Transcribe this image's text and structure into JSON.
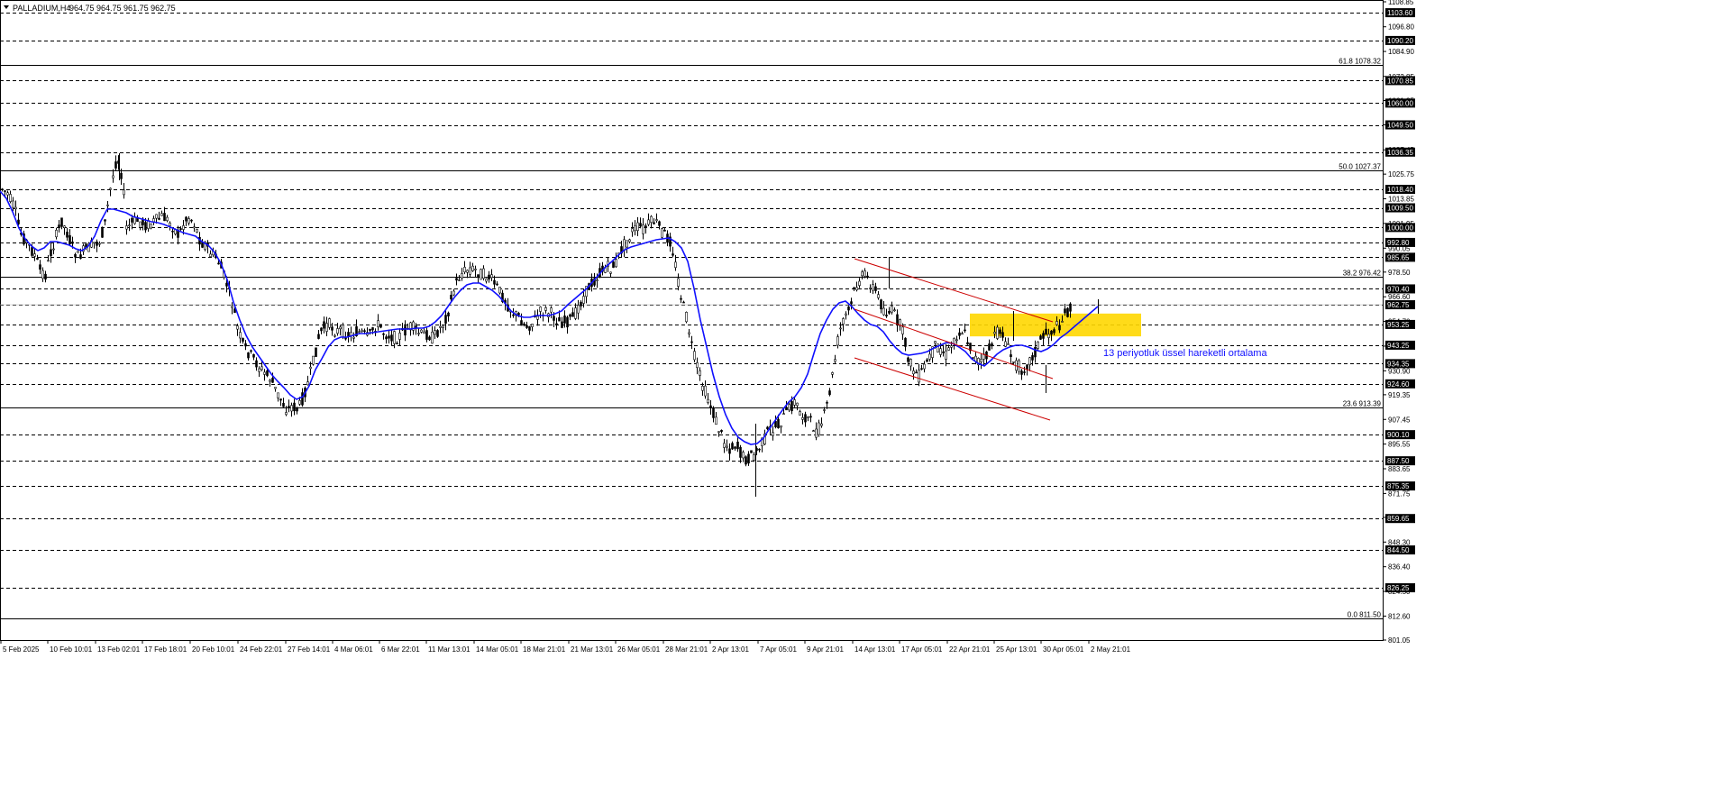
{
  "header": {
    "title": "PALLADIUM,H4",
    "ohlc": "964.75 964.75 961.75 962.75"
  },
  "chart_data": {
    "type": "candlestick",
    "symbol": "PALLADIUM",
    "timeframe": "H4",
    "ylim": [
      801.05,
      1108.85
    ],
    "grid": "dashed horizontal lines at marked price levels",
    "last_price": 962.75,
    "y_ticks": [
      "1108.85",
      "1096.80",
      "1084.90",
      "1072.85",
      "1061.25",
      "1049.50",
      "1037.45",
      "1025.75",
      "1013.85",
      "1001.95",
      "990.05",
      "978.50",
      "966.60",
      "954.70",
      "942.80",
      "930.90",
      "919.35",
      "907.45",
      "895.55",
      "883.65",
      "871.75",
      "860.20",
      "848.30",
      "836.40",
      "824.50",
      "812.60",
      "801.05"
    ],
    "y_tick_values": [
      1108.85,
      1096.8,
      1084.9,
      1072.85,
      1061.25,
      1049.5,
      1037.45,
      1025.75,
      1013.85,
      1001.95,
      990.05,
      978.5,
      966.6,
      954.7,
      942.8,
      930.9,
      919.35,
      907.45,
      895.55,
      883.65,
      871.75,
      860.2,
      848.3,
      836.4,
      824.5,
      812.6,
      801.05
    ],
    "price_levels": [
      "1103.60",
      "1090.20",
      "1070.85",
      "1060.00",
      "1049.50",
      "1036.35",
      "1018.40",
      "1009.50",
      "1000.00",
      "992.80",
      "985.65",
      "970.40",
      "962.75",
      "953.25",
      "943.25",
      "934.35",
      "924.60",
      "900.10",
      "887.50",
      "875.35",
      "859.65",
      "844.50",
      "826.25"
    ],
    "price_level_values": [
      1103.6,
      1090.2,
      1070.85,
      1060.0,
      1049.5,
      1036.35,
      1018.4,
      1009.5,
      1000.0,
      992.8,
      985.65,
      970.4,
      962.75,
      953.25,
      943.25,
      934.35,
      924.6,
      900.1,
      887.5,
      875.35,
      859.65,
      844.5,
      826.25
    ],
    "fibonacci": [
      {
        "label": "61.8 1078.32",
        "value": 1078.32
      },
      {
        "label": "50.0 1027.37",
        "value": 1027.37
      },
      {
        "label": "38.2 976.42",
        "value": 976.42
      },
      {
        "label": "23.6 913.39",
        "value": 913.39
      },
      {
        "label": "0.0 811.50",
        "value": 811.5
      }
    ],
    "x_labels": [
      "5 Feb 2025",
      "10 Feb 10:01",
      "13 Feb 02:01",
      "17 Feb 18:01",
      "20 Feb 10:01",
      "24 Feb 22:01",
      "27 Feb 14:01",
      "4 Mar 06:01",
      "6 Mar 22:01",
      "11 Mar 13:01",
      "14 Mar 05:01",
      "18 Mar 21:01",
      "21 Mar 13:01",
      "26 Mar 05:01",
      "28 Mar 21:01",
      "2 Apr 13:01",
      "7 Apr 05:01",
      "9 Apr 21:01",
      "14 Apr 13:01",
      "17 Apr 05:01",
      "22 Apr 21:01",
      "25 Apr 13:01",
      "30 Apr 05:01",
      "2 May 21:01"
    ],
    "price_path": {
      "x": [
        0,
        8,
        16,
        22,
        30,
        38,
        44,
        50,
        56,
        62,
        68,
        74,
        80,
        86,
        92,
        98,
        104,
        110,
        116,
        122,
        128,
        132,
        136,
        140,
        144,
        150,
        156,
        162,
        168,
        174,
        180,
        186,
        192,
        198,
        204,
        210,
        216,
        222,
        228,
        234,
        240,
        246,
        252,
        258,
        264,
        270,
        276,
        282,
        288,
        294,
        300,
        306,
        312,
        318,
        324,
        330,
        336,
        342,
        348,
        354,
        360,
        366,
        372,
        378,
        384,
        390,
        396,
        402,
        408,
        414,
        420,
        426,
        432,
        438,
        444,
        450,
        456,
        462,
        468,
        474,
        480,
        486,
        492,
        498,
        504,
        510,
        516,
        522,
        528,
        534,
        540,
        546,
        552,
        558,
        564,
        570,
        576,
        582,
        588,
        594,
        600,
        606,
        612,
        618,
        624,
        630,
        636,
        642,
        648,
        654,
        660,
        666,
        672,
        678,
        684,
        690,
        696,
        702,
        708,
        714,
        720,
        726,
        732,
        738,
        744,
        750,
        756,
        762,
        768,
        774,
        780,
        786,
        792,
        798,
        804,
        810,
        816,
        822,
        828,
        834,
        840,
        846,
        852,
        858,
        864,
        870,
        876,
        882,
        888,
        894,
        900,
        906,
        912,
        918,
        924,
        930,
        936,
        942,
        948,
        954,
        960,
        966,
        972,
        978,
        984,
        990,
        996,
        1002,
        1008,
        1014,
        1020,
        1026,
        1032,
        1038,
        1044,
        1050,
        1056,
        1062,
        1068,
        1074,
        1080,
        1086,
        1092,
        1098,
        1104,
        1110,
        1116,
        1122,
        1128,
        1134,
        1140,
        1146,
        1152,
        1158,
        1164,
        1170,
        1176,
        1182,
        1188,
        1194,
        1200,
        1206,
        1212,
        1218
      ],
      "y": [
        208,
        215,
        232,
        258,
        270,
        283,
        300,
        305,
        280,
        262,
        245,
        258,
        275,
        285,
        279,
        275,
        270,
        268,
        248,
        210,
        180,
        178,
        205,
        252,
        250,
        245,
        246,
        250,
        247,
        244,
        240,
        245,
        252,
        262,
        246,
        240,
        250,
        268,
        272,
        282,
        286,
        300,
        318,
        340,
        368,
        385,
        392,
        400,
        408,
        415,
        420,
        435,
        445,
        455,
        450,
        455,
        440,
        422,
        398,
        370,
        362,
        360,
        368,
        366,
        370,
        372,
        368,
        370,
        375,
        364,
        360,
        370,
        372,
        375,
        372,
        366,
        362,
        368,
        372,
        370,
        375,
        366,
        358,
        342,
        318,
        305,
        300,
        298,
        300,
        304,
        306,
        312,
        320,
        330,
        340,
        348,
        352,
        362,
        360,
        354,
        345,
        345,
        349,
        355,
        358,
        356,
        353,
        338,
        328,
        316,
        310,
        302,
        296,
        298,
        290,
        274,
        266,
        255,
        252,
        254,
        248,
        245,
        254,
        262,
        268,
        300,
        334,
        355,
        390,
        410,
        430,
        445,
        462,
        478,
        492,
        498,
        492,
        505,
        510,
        506,
        500,
        490,
        478,
        476,
        470,
        462,
        452,
        445,
        460,
        462,
        470,
        480,
        468,
        446,
        412,
        372,
        352,
        345,
        320,
        308,
        305,
        315,
        325,
        340,
        348,
        345,
        356,
        372,
        400,
        412,
        418,
        405,
        395,
        382,
        388,
        395,
        380,
        370,
        366,
        380,
        395,
        402,
        398,
        386,
        372,
        365,
        382,
        398,
        405,
        410,
        402,
        395,
        380,
        372,
        368,
        365,
        358,
        348,
        340
      ]
    },
    "ema": {
      "label": "13 periyotluk üssel hareketli ortalama",
      "color": "#1010ff",
      "y": [
        212,
        220,
        235,
        253,
        265,
        273,
        278,
        275,
        268,
        268,
        270,
        272,
        276,
        278,
        273,
        262,
        245,
        232,
        232,
        234,
        236,
        240,
        242,
        244,
        246,
        247,
        249,
        252,
        255,
        258,
        260,
        262,
        268,
        272,
        280,
        292,
        310,
        335,
        355,
        372,
        385,
        395,
        405,
        415,
        423,
        430,
        438,
        443,
        440,
        428,
        410,
        398,
        385,
        377,
        374,
        374,
        372,
        370,
        370,
        369,
        368,
        367,
        366,
        365,
        365,
        365,
        364,
        364,
        362,
        357,
        350,
        340,
        330,
        322,
        316,
        314,
        314,
        318,
        322,
        328,
        336,
        345,
        350,
        352,
        352,
        350,
        350,
        350,
        348,
        345,
        338,
        332,
        326,
        320,
        312,
        304,
        296,
        290,
        283,
        277,
        274,
        272,
        270,
        268,
        266,
        265,
        264,
        268,
        275,
        290,
        320,
        355,
        385,
        415,
        440,
        460,
        475,
        485,
        490,
        493,
        492,
        486,
        475,
        465,
        455,
        446,
        440,
        430,
        415,
        392,
        370,
        355,
        343,
        336,
        334,
        340,
        348,
        355,
        360,
        362,
        368,
        378,
        386,
        392,
        394,
        393,
        392,
        390,
        386,
        383,
        380,
        381,
        385,
        390,
        398,
        403,
        406,
        400,
        393,
        388,
        385,
        383,
        383,
        385,
        388,
        390,
        387,
        382,
        375,
        370,
        364,
        358,
        352,
        346,
        340
      ],
      "ema_x_start": 0,
      "ema_x_step": 6
    },
    "channel_lines": [
      {
        "x1": 948,
        "y1": 287,
        "x2": 1168,
        "y2": 357
      },
      {
        "x1": 948,
        "y1": 343,
        "x2": 1168,
        "y2": 420
      },
      {
        "x1": 948,
        "y1": 397,
        "x2": 1165,
        "y2": 466
      }
    ],
    "resistance_zone": {
      "y_top": 947.5,
      "y_bottom": 958.5
    },
    "annotation": "13 periyotluk üssel hareketli ortalama",
    "colors": {
      "candle": "#000000",
      "ema": "#1010ff",
      "zone": "#ffd700",
      "channel": "#cc0000",
      "label_box": "#000000"
    }
  }
}
